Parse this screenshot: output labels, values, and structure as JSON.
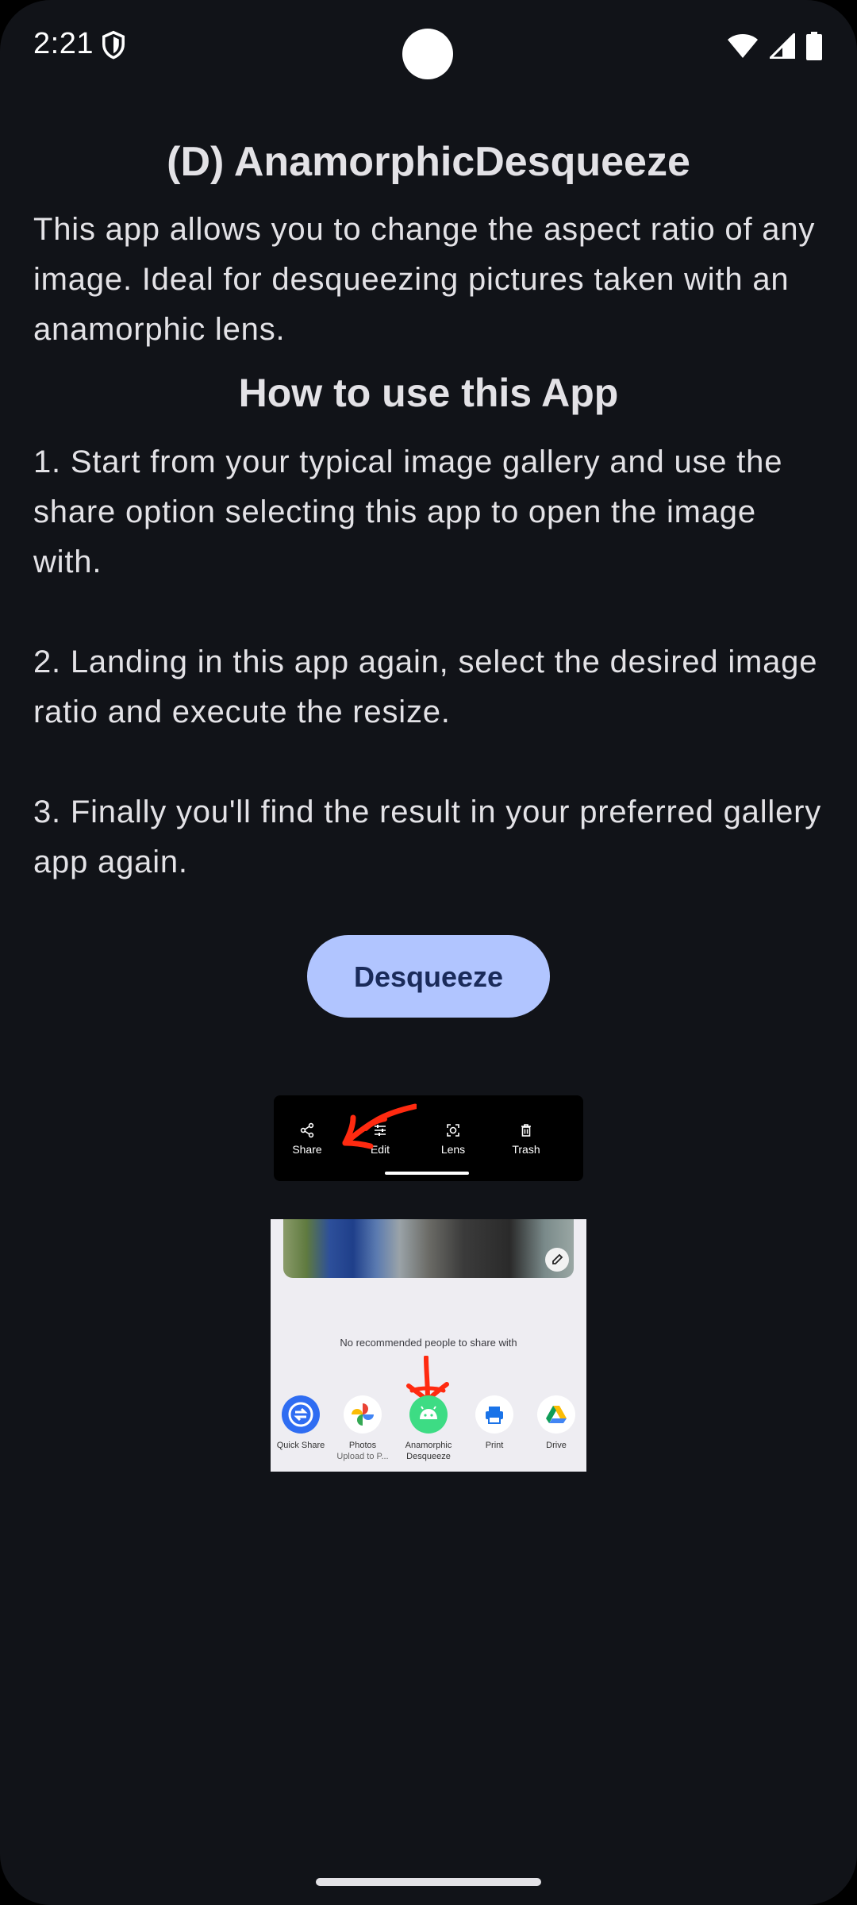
{
  "status_bar": {
    "time": "2:21",
    "icons": [
      "shield-icon",
      "wifi-icon",
      "signal-icon",
      "battery-icon"
    ]
  },
  "app": {
    "title": "(D) AnamorphicDesqueeze",
    "intro": "This app allows you to change the aspect ratio of any image. Ideal for desqueezing pictures taken with an anamorphic lens.",
    "howto_title": "How to use this App",
    "steps": [
      "1. Start from your typical image gallery and use the share option selecting this app to open the image with.",
      "2. Landing in this app again, select the desired image ratio and execute the resize.",
      "3. Finally you'll find the result in your preferred gallery app again."
    ],
    "button_label": "Desqueeze"
  },
  "illustration_actions": {
    "items": [
      {
        "label": "Share",
        "icon": "share-icon"
      },
      {
        "label": "Edit",
        "icon": "sliders-icon"
      },
      {
        "label": "Lens",
        "icon": "lens-icon"
      },
      {
        "label": "Trash",
        "icon": "trash-icon"
      }
    ]
  },
  "illustration_share": {
    "message": "No recommended people to share with",
    "targets": [
      {
        "label": "Quick Share",
        "sub": "",
        "icon": "quick-share-icon"
      },
      {
        "label": "Photos",
        "sub": "Upload to P...",
        "icon": "photos-pinwheel-icon"
      },
      {
        "label": "Anamorphic",
        "sub": "Desqueeze",
        "icon": "android-icon"
      },
      {
        "label": "Print",
        "sub": "",
        "icon": "printer-icon"
      },
      {
        "label": "Drive",
        "sub": "",
        "icon": "drive-icon"
      }
    ]
  },
  "colors": {
    "background": "#111318",
    "button": "#b1c5ff",
    "button_text": "#1a2b5a",
    "annotation_arrow": "#ff2a10"
  }
}
